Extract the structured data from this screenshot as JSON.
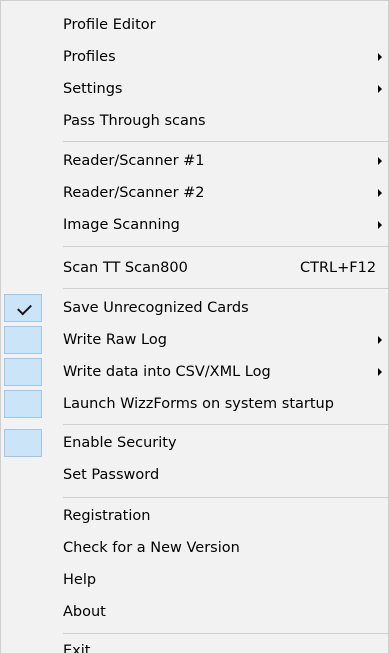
{
  "menu": {
    "items": [
      {
        "label": "Profile Editor"
      },
      {
        "label": "Profiles"
      },
      {
        "label": "Settings"
      },
      {
        "label": "Pass Through scans"
      },
      {
        "label": "Reader/Scanner #1"
      },
      {
        "label": "Reader/Scanner #2"
      },
      {
        "label": "Image Scanning"
      },
      {
        "label": "Scan TT Scan800",
        "shortcut": "CTRL+F12"
      },
      {
        "label": "Save Unrecognized Cards",
        "checked": true
      },
      {
        "label": "Write Raw Log",
        "checked": false
      },
      {
        "label": "Write data into CSV/XML Log",
        "checked": false
      },
      {
        "label": "Launch WizzForms on system startup",
        "checked": false
      },
      {
        "label": "Enable Security",
        "checked": false
      },
      {
        "label": "Set Password"
      },
      {
        "label": "Registration"
      },
      {
        "label": "Check for a New Version"
      },
      {
        "label": "Help"
      },
      {
        "label": "About"
      },
      {
        "label": "Exit"
      }
    ]
  }
}
